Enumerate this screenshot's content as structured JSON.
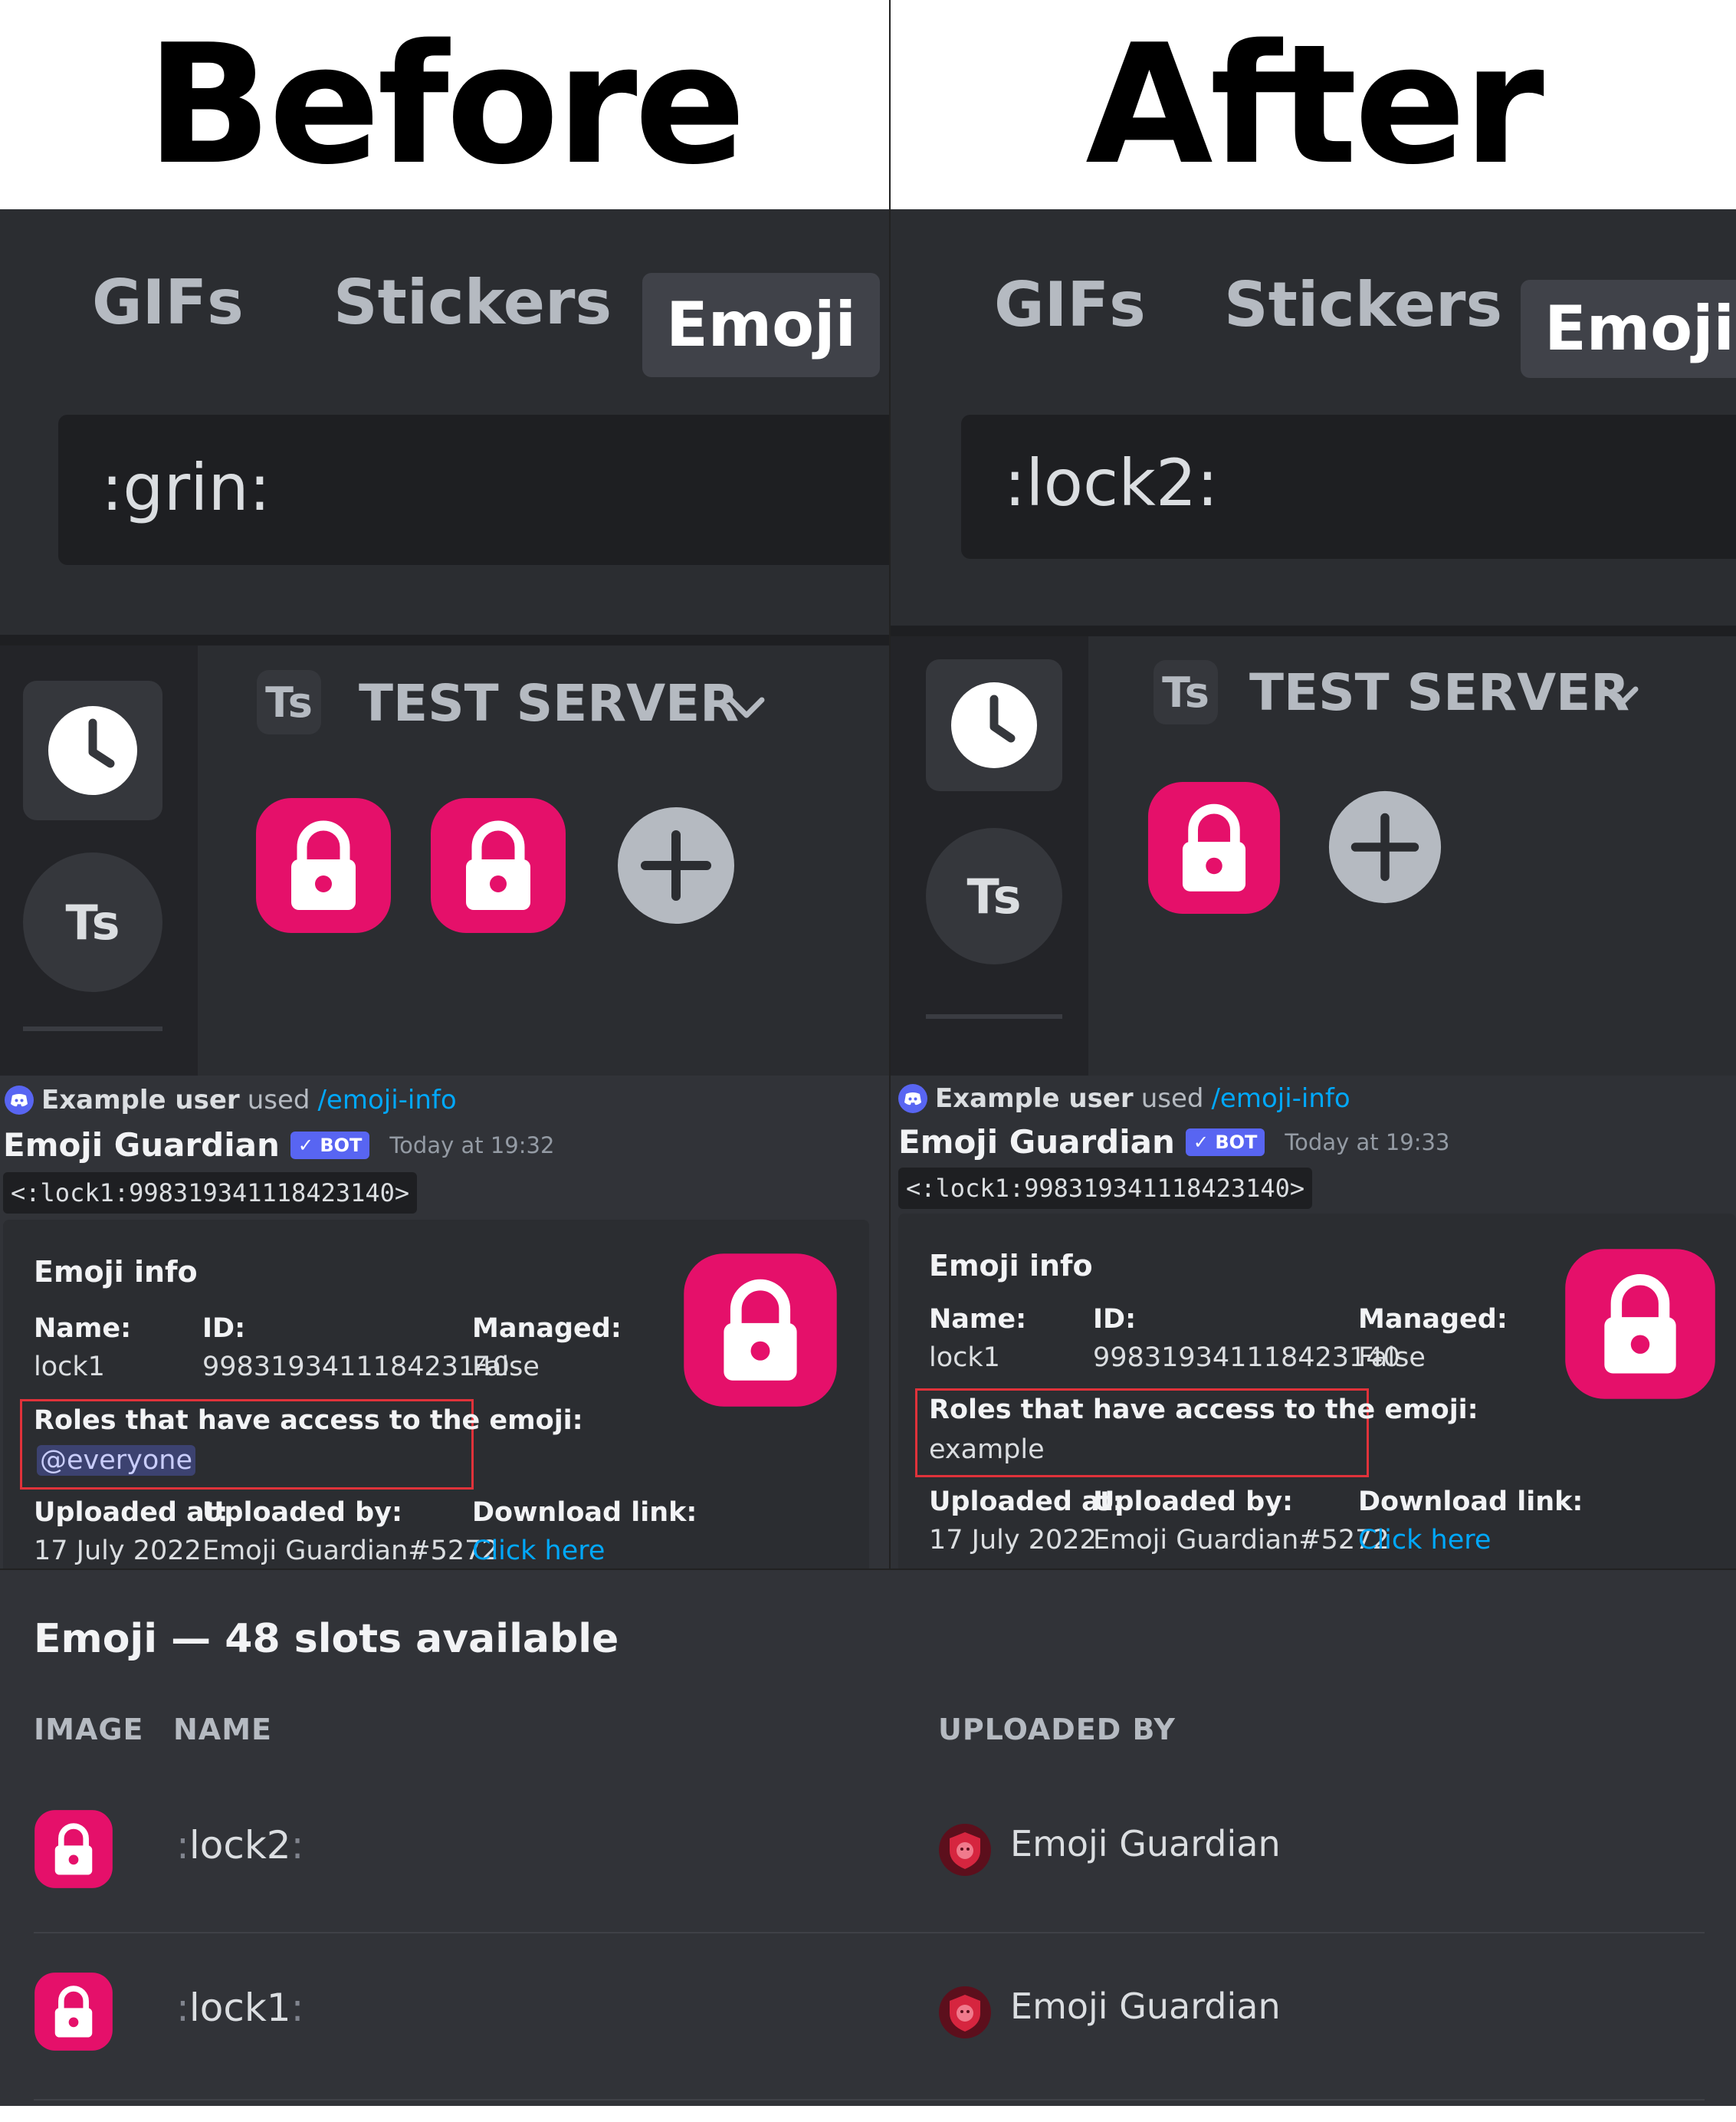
{
  "headings": {
    "before": "Before",
    "after": "After"
  },
  "before": {
    "tabs": {
      "gifs": "GIFs",
      "stickers": "Stickers",
      "emoji": "Emoji"
    },
    "search_value": ":grin:",
    "rail_server_initials": "Ts",
    "server_badge": "Ts",
    "server_name": "TEST SERVER",
    "message": {
      "user": "Example user",
      "used_text": "used",
      "command": "/emoji-info",
      "author": "Emoji Guardian",
      "bot_tag": "✓ BOT",
      "timestamp": "Today at 19:32",
      "code": "<:lock1:998319341118423140>",
      "embed": {
        "title": "Emoji info",
        "name_label": "Name:",
        "name_value": "lock1",
        "id_label": "ID:",
        "id_value": "998319341118423140",
        "managed_label": "Managed:",
        "managed_value": "False",
        "roles_label": "Roles that have access to the emoji:",
        "roles_value": "@everyone",
        "uploaded_at_label": "Uploaded at:",
        "uploaded_at_value": "17 July 2022",
        "uploaded_by_label": "Uploaded by:",
        "uploaded_by_value": "Emoji Guardian#5272",
        "download_label": "Download link:",
        "download_value": "Click here"
      }
    }
  },
  "after": {
    "tabs": {
      "gifs": "GIFs",
      "stickers": "Stickers",
      "emoji": "Emoji"
    },
    "search_value": ":lock2:",
    "rail_server_initials": "Ts",
    "server_badge": "Ts",
    "server_name": "TEST SERVER",
    "message": {
      "user": "Example user",
      "used_text": "used",
      "command": "/emoji-info",
      "author": "Emoji Guardian",
      "bot_tag": "✓ BOT",
      "timestamp": "Today at 19:33",
      "code": "<:lock1:998319341118423140>",
      "embed": {
        "title": "Emoji info",
        "name_label": "Name:",
        "name_value": "lock1",
        "id_label": "ID:",
        "id_value": "998319341118423140",
        "managed_label": "Managed:",
        "managed_value": "False",
        "roles_label": "Roles that have access to the emoji:",
        "roles_value": "example",
        "uploaded_at_label": "Uploaded at:",
        "uploaded_at_value": "17 July 2022",
        "uploaded_by_label": "Uploaded by:",
        "uploaded_by_value": "Emoji Guardian#5272",
        "download_label": "Download link:",
        "download_value": "Click here"
      }
    }
  },
  "emoji_list": {
    "title": "Emoji — 48 slots available",
    "columns": {
      "image": "IMAGE",
      "name": "NAME",
      "uploaded_by": "UPLOADED BY"
    },
    "rows": [
      {
        "name": "lock2",
        "uploader": "Emoji Guardian"
      },
      {
        "name": "lock1",
        "uploader": "Emoji Guardian"
      }
    ]
  },
  "colors": {
    "emoji_pink": "#e5106a",
    "link_blue": "#00a8fc",
    "highlight_red": "#e0323a",
    "blurple": "#5865f2"
  },
  "icons": [
    "clock-icon",
    "lock-emoji-icon",
    "add-icon",
    "chevron-down-icon",
    "discord-icon",
    "avatar-icon"
  ]
}
